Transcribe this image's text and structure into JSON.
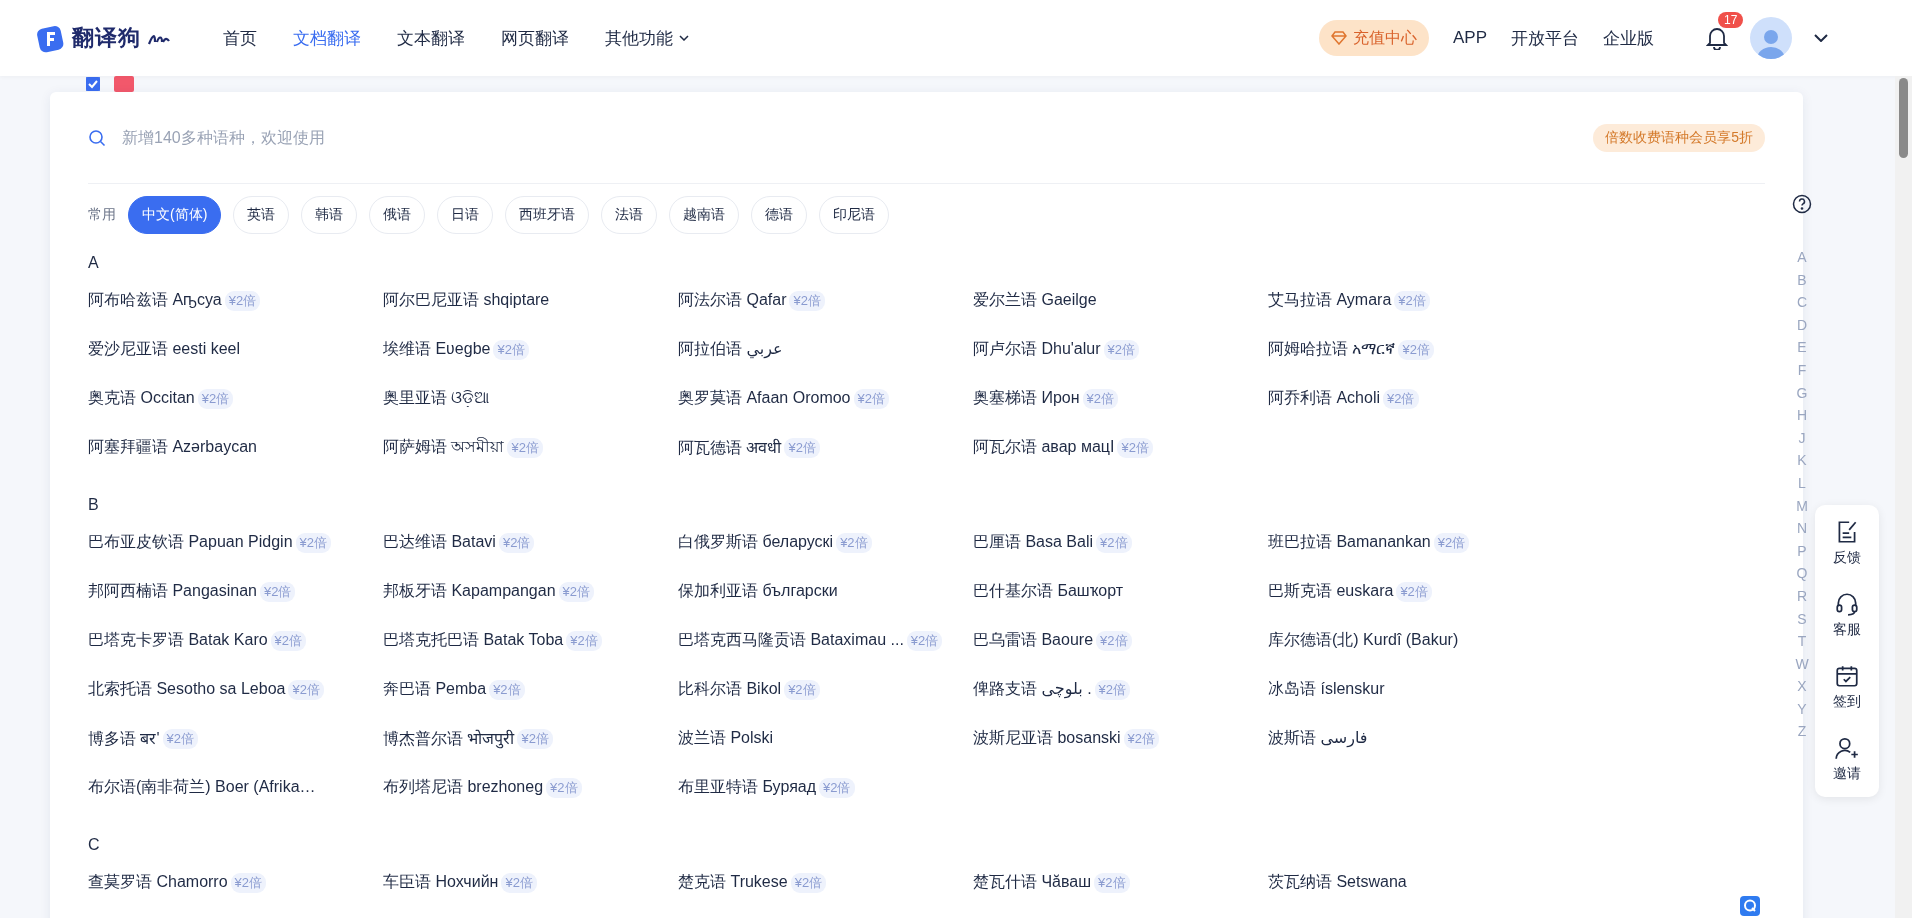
{
  "header": {
    "logo": "翻译狗",
    "nav": [
      {
        "label": "首页",
        "selected": false,
        "dropdown": false
      },
      {
        "label": "文档翻译",
        "selected": true,
        "dropdown": false
      },
      {
        "label": "文本翻译",
        "selected": false,
        "dropdown": false
      },
      {
        "label": "网页翻译",
        "selected": false,
        "dropdown": false
      },
      {
        "label": "其他功能",
        "selected": false,
        "dropdown": true
      }
    ],
    "recharge": "充值中心",
    "links": [
      "APP",
      "开放平台",
      "企业版"
    ],
    "notifications": "17"
  },
  "background_row": {
    "checked": true
  },
  "search": {
    "placeholder": "新增140多种语种，欢迎使用"
  },
  "promo": "倍数收费语种会员享5折",
  "common": {
    "label": "常用",
    "chips": [
      {
        "label": "中文(简体)",
        "selected": true
      },
      {
        "label": "英语",
        "selected": false
      },
      {
        "label": "韩语",
        "selected": false
      },
      {
        "label": "俄语",
        "selected": false
      },
      {
        "label": "日语",
        "selected": false
      },
      {
        "label": "西班牙语",
        "selected": false
      },
      {
        "label": "法语",
        "selected": false
      },
      {
        "label": "越南语",
        "selected": false
      },
      {
        "label": "德语",
        "selected": false
      },
      {
        "label": "印尼语",
        "selected": false
      }
    ]
  },
  "sections": [
    {
      "letter": "A",
      "items": [
        {
          "name": "阿布哈兹语 Аҧсуа",
          "badge": "¥2倍"
        },
        {
          "name": "阿尔巴尼亚语 shqiptare"
        },
        {
          "name": "阿法尔语 Qafar",
          "badge": "¥2倍"
        },
        {
          "name": "爱尔兰语 Gaeilge"
        },
        {
          "name": "艾马拉语 Aymara",
          "badge": "¥2倍"
        },
        {
          "name": "爱沙尼亚语 eesti keel"
        },
        {
          "name": "埃维语 Eʋegbe",
          "badge": "¥2倍"
        },
        {
          "name": "阿拉伯语 عربي"
        },
        {
          "name": "阿卢尔语 Dhu'alur",
          "badge": "¥2倍"
        },
        {
          "name": "阿姆哈拉语 አማርኛ",
          "badge": "¥2倍"
        },
        {
          "name": "奥克语 Occitan",
          "badge": "¥2倍"
        },
        {
          "name": "奥里亚语 ଓଡ଼ିଆ"
        },
        {
          "name": "奥罗莫语 Afaan Oromoo",
          "badge": "¥2倍"
        },
        {
          "name": "奥塞梯语 Ирон",
          "badge": "¥2倍"
        },
        {
          "name": "阿乔利语 Acholi",
          "badge": "¥2倍"
        },
        {
          "name": "阿塞拜疆语 Azərbaycan"
        },
        {
          "name": "阿萨姆语 অসমীয়া",
          "badge": "¥2倍"
        },
        {
          "name": "阿瓦德语 अवधी",
          "badge": "¥2倍"
        },
        {
          "name": "阿瓦尔语 авар мацӀ",
          "badge": "¥2倍"
        }
      ]
    },
    {
      "letter": "B",
      "items": [
        {
          "name": "巴布亚皮钦语 Papuan Pidgin",
          "badge": "¥2倍"
        },
        {
          "name": "巴达维语 Batavi",
          "badge": "¥2倍"
        },
        {
          "name": "白俄罗斯语 беларускі",
          "badge": "¥2倍"
        },
        {
          "name": "巴厘语 Basa Bali",
          "badge": "¥2倍"
        },
        {
          "name": "班巴拉语 Bamanankan",
          "badge": "¥2倍"
        },
        {
          "name": "邦阿西楠语 Pangasinan",
          "badge": "¥2倍"
        },
        {
          "name": "邦板牙语 Kapampangan",
          "badge": "¥2倍"
        },
        {
          "name": "保加利亚语 български"
        },
        {
          "name": "巴什基尔语 Башҡорт"
        },
        {
          "name": "巴斯克语 euskara",
          "badge": "¥2倍"
        },
        {
          "name": "巴塔克卡罗语 Batak Karo",
          "badge": "¥2倍"
        },
        {
          "name": "巴塔克托巴语 Batak Toba",
          "badge": "¥2倍"
        },
        {
          "name": "巴塔克西马隆贡语 Bataximau ...",
          "badge": "¥2倍"
        },
        {
          "name": "巴乌雷语 Baoure",
          "badge": "¥2倍"
        },
        {
          "name": "库尔德语(北) Kurdî (Bakur)"
        },
        {
          "name": "北索托语 Sesotho sa Leboa",
          "badge": "¥2倍"
        },
        {
          "name": "奔巴语 Pemba",
          "badge": "¥2倍"
        },
        {
          "name": "比科尔语 Bikol",
          "badge": "¥2倍"
        },
        {
          "name": "俾路支语 بلوچی .",
          "badge": "¥2倍"
        },
        {
          "name": "冰岛语 íslenskur"
        },
        {
          "name": "博多语 बर'",
          "badge": "¥2倍"
        },
        {
          "name": "博杰普尔语 भोजपुरी",
          "badge": "¥2倍"
        },
        {
          "name": "波兰语 Polski"
        },
        {
          "name": "波斯尼亚语 bosanski",
          "badge": "¥2倍"
        },
        {
          "name": "波斯语 فارسی"
        },
        {
          "name": "布尔语(南非荷兰) Boer (Afrika…"
        },
        {
          "name": "布列塔尼语 brezhoneg",
          "badge": "¥2倍"
        },
        {
          "name": "布里亚特语 Буряад",
          "badge": "¥2倍"
        }
      ]
    },
    {
      "letter": "C",
      "items": [
        {
          "name": "查莫罗语 Chamorro",
          "badge": "¥2倍"
        },
        {
          "name": "车臣语 Нохчийн",
          "badge": "¥2倍"
        },
        {
          "name": "楚克语 Trukese",
          "badge": "¥2倍"
        },
        {
          "name": "楚瓦什语 Чӑваш",
          "badge": "¥2倍"
        },
        {
          "name": "茨瓦纳语 Setswana"
        }
      ]
    }
  ],
  "alphabet": [
    "A",
    "B",
    "C",
    "D",
    "E",
    "F",
    "G",
    "H",
    "J",
    "K",
    "L",
    "M",
    "N",
    "P",
    "Q",
    "R",
    "S",
    "T",
    "W",
    "X",
    "Y",
    "Z"
  ],
  "float_menu": [
    {
      "kind": "feedback",
      "label": "反馈"
    },
    {
      "kind": "service",
      "label": "客服"
    },
    {
      "kind": "checkin",
      "label": "签到"
    },
    {
      "kind": "invite",
      "label": "邀请"
    }
  ]
}
